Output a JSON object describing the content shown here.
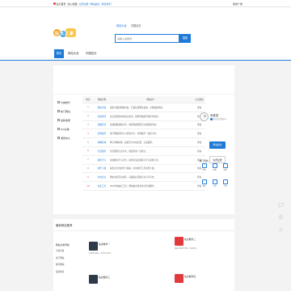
{
  "topbar": {
    "links": [
      "设为首页",
      "加入收藏",
      "立即注册",
      "网站提交",
      "联系我们"
    ],
    "right_label": "我的广告"
  },
  "header": {
    "logo_text": "站长之家",
    "search_tabs": [
      "网站大全",
      "中国站长"
    ],
    "search_placeholder": "请输入关键词",
    "search_value": "请输入关键词",
    "search_button": "搜索"
  },
  "nav": {
    "items": [
      "首页",
      "网站大全",
      "中国站长"
    ]
  },
  "categories": [
    "分类排行",
    "热门网址",
    "最新收录",
    "QQ头像",
    "游戏中心"
  ],
  "rank_table": {
    "headers": [
      "排名",
      "网站名称",
      "网站简介",
      "点击数量"
    ],
    "rows": [
      {
        "rank": "1",
        "name": "网址导航",
        "desc": "提供全面的网站导航，汇集优质网址资源，方便快捷查找。",
        "clicks": "查看"
      },
      {
        "rank": "2",
        "name": "新闻资讯",
        "desc": "每日更新国内外热点新闻，财经科技娱乐体育等资讯。",
        "clicks": "查看"
      },
      {
        "rank": "3",
        "name": "视频影音",
        "desc": "在线视频观看平台，电影电视剧综艺动漫资源丰富。",
        "clicks": "查看"
      },
      {
        "rank": "4",
        "name": "游戏娱乐",
        "desc": "热门网络游戏与小游戏大全，休闲娱乐一站式平台。",
        "clicks": "查看"
      },
      {
        "rank": "5",
        "name": "购物商城",
        "desc": "网上购物商城，品类齐全价格实惠，正品保障。",
        "clicks": "查看"
      },
      {
        "rank": "6",
        "name": "生活服务",
        "desc": "生活服务信息平台，便民查询一应俱全。",
        "clicks": "查看"
      },
      {
        "rank": "7",
        "name": "教育学习",
        "desc": "在线教育学习平台，提供丰富的课程与学习资料分享。",
        "clicks": "查看"
      },
      {
        "rank": "8",
        "name": "软件下载",
        "desc": "绿色安全的软件下载站，常用软件工具免费下载。",
        "clicks": "查看"
      },
      {
        "rank": "9",
        "name": "社交论坛",
        "desc": "网友交流互动社区，兴趣爱好话题讨论分享平台。",
        "clicks": "查看"
      },
      {
        "rank": "10",
        "name": "站长工具",
        "desc": "SEO查询站长工具，网站收录排名综合查询服务。",
        "clicks": "查看"
      }
    ]
  },
  "user": {
    "name": "未登录",
    "level": "登录后查看更多",
    "submit_button": "网站提交",
    "register_button": "免费注册"
  },
  "shortcuts": {
    "title": "热门导航",
    "items": [
      "网站",
      "文章",
      "头像",
      "游戏",
      "工具",
      "下载"
    ]
  },
  "bottom": {
    "title": "最新网站推荐",
    "nav_heading": "网站分类导航",
    "nav_items": [
      "分类导航",
      "热门网站",
      "推荐网站",
      "最新收录"
    ],
    "sites": [
      {
        "name": "站点推荐一",
        "desc": "优质网站推荐，欢迎访问浏览。",
        "color": "#2d3a4a"
      },
      {
        "name": "站点推荐二",
        "desc": "精彩内容每日更新，欢迎访问。",
        "color": "#e4393c"
      },
      {
        "name": "站点推荐三",
        "desc": "资讯服务平台，欢迎访问浏览。",
        "color": "#2d3a4a"
      },
      {
        "name": "站点推荐四",
        "desc": "综合门户网站，欢迎访问浏览。",
        "color": "#e4393c"
      }
    ]
  },
  "colors": {
    "accent": "#1e7ad6",
    "rank": "#e4393c"
  }
}
